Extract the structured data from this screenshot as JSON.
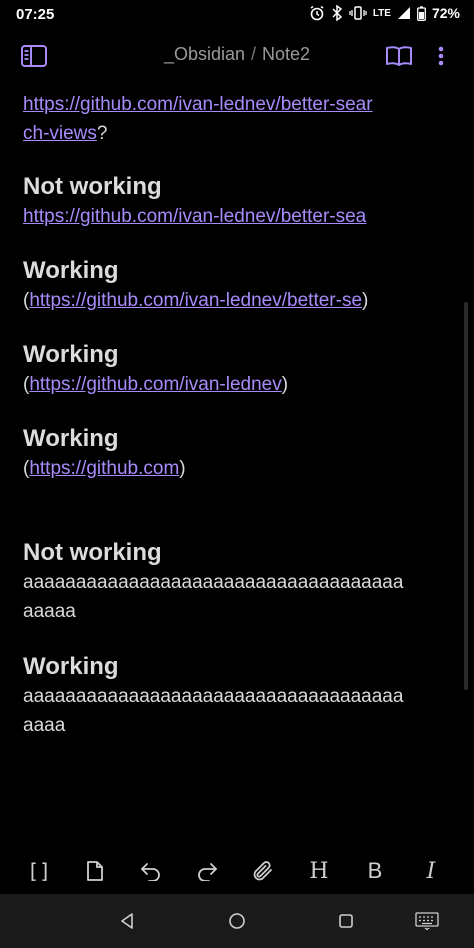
{
  "status": {
    "time": "07:25",
    "battery": "72%",
    "network": "LTE"
  },
  "header": {
    "vault": "_Obsidian",
    "separator": "/",
    "note": "Note2"
  },
  "colors": {
    "accent": "#a88bfa",
    "background": "#000000",
    "text": "#dadada"
  },
  "document": {
    "block0": {
      "link_part1": "https://github.com/ivan-lednev/better-sear",
      "link_part2": "ch-views",
      "trail": "?"
    },
    "block1": {
      "heading": "Not working",
      "link": "https://github.com/ivan-lednev/better-sea"
    },
    "block2": {
      "heading": "Working",
      "open": "(",
      "link": "https://github.com/ivan-lednev/better-se",
      "close": ")"
    },
    "block3": {
      "heading": "Working",
      "open": "(",
      "link": "https://github.com/ivan-lednev",
      "close": ")"
    },
    "block4": {
      "heading": "Working",
      "open": "(",
      "link": "https://github.com",
      "close": ")"
    },
    "block5": {
      "heading": "Not working",
      "line1": "aaaaaaaaaaaaaaaaaaaaaaaaaaaaaaaaaaaa",
      "line2": "aaaaa"
    },
    "block6": {
      "heading": "Working",
      "line1": "aaaaaaaaaaaaaaaaaaaaaaaaaaaaaaaaaaaa",
      "line2": "aaaa"
    }
  },
  "toolbar": {
    "items": [
      {
        "icon": "brackets-icon",
        "label": "[]"
      },
      {
        "icon": "file-icon"
      },
      {
        "icon": "undo-icon"
      },
      {
        "icon": "redo-icon"
      },
      {
        "icon": "paperclip-icon"
      },
      {
        "icon": "heading-icon",
        "label": "H"
      },
      {
        "icon": "bold-icon",
        "label": "B"
      },
      {
        "icon": "italic-icon",
        "label": "I"
      }
    ]
  }
}
